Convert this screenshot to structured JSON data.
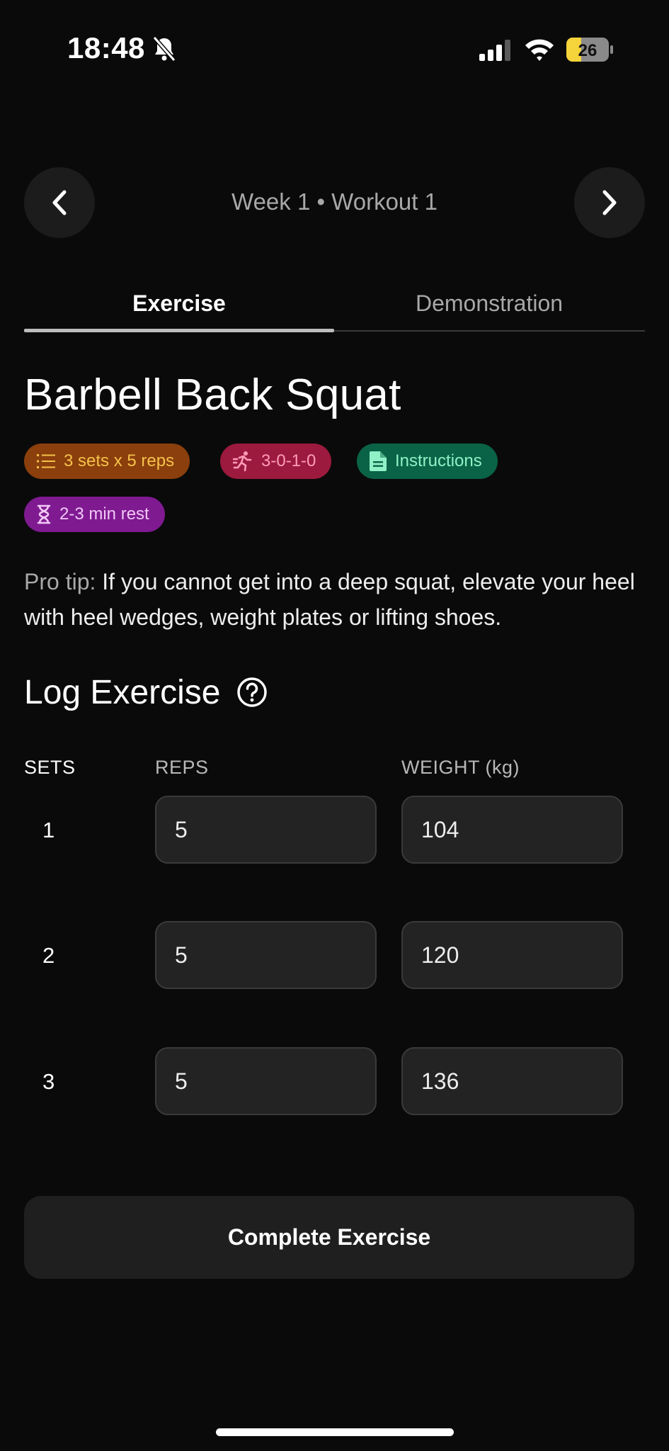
{
  "status_bar": {
    "time": "18:48",
    "battery_level": "26",
    "icons": [
      "bell-slash-icon",
      "cellular-signal-icon",
      "wifi-icon",
      "battery-icon"
    ]
  },
  "header": {
    "title": "Week 1 • Workout 1",
    "prev_icon": "chevron-left-icon",
    "next_icon": "chevron-right-icon"
  },
  "tabs": [
    {
      "label": "Exercise",
      "active": true
    },
    {
      "label": "Demonstration",
      "active": false
    }
  ],
  "exercise": {
    "title": "Barbell Back Squat",
    "badges": [
      {
        "label": "3 sets x 5 reps",
        "icon": "list-icon",
        "bg": "#8b3f0c",
        "fg": "#f5c24b"
      },
      {
        "label": "3-0-1-0",
        "icon": "running-person-icon",
        "bg": "#9c1a3e",
        "fg": "#ff9bb8"
      },
      {
        "label": "Instructions",
        "icon": "document-icon",
        "bg": "#0a6346",
        "fg": "#8ff1c6"
      },
      {
        "label": "2-3 min rest",
        "icon": "hourglass-icon",
        "bg": "#7f1a91",
        "fg": "#f1c7f7"
      }
    ],
    "pro_tip_label": "Pro tip:",
    "pro_tip_text": "If you cannot get into a deep squat, elevate your heel with heel wedges, weight plates or lifting shoes."
  },
  "log": {
    "title": "Log Exercise",
    "help_icon": "question-circle-icon",
    "columns": {
      "sets": "SETS",
      "reps": "REPS",
      "weight": "WEIGHT (kg)"
    },
    "sets": [
      {
        "set": "1",
        "reps": "5",
        "weight": "104"
      },
      {
        "set": "2",
        "reps": "5",
        "weight": "120"
      },
      {
        "set": "3",
        "reps": "5",
        "weight": "136"
      }
    ]
  },
  "actions": {
    "complete_label": "Complete Exercise"
  },
  "colors": {
    "background": "#0a0a0a",
    "surface": "#232323",
    "battery_fill": "#f5d33a"
  }
}
